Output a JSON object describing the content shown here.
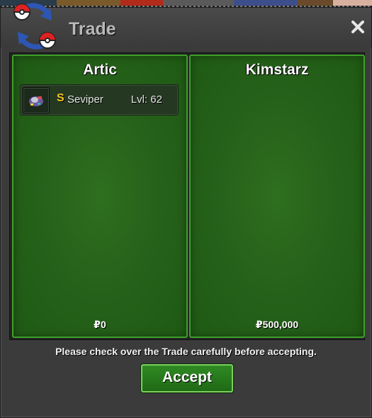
{
  "window": {
    "title": "Trade",
    "close_icon": "close-icon",
    "logo_icon": "trade-logo-icon"
  },
  "trade": {
    "left": {
      "player": "Artic",
      "items": [
        {
          "icon": "pokemon-sprite-icon",
          "badge": "S",
          "name": "Seviper",
          "level": "Lvl: 62"
        }
      ],
      "currency_symbol": "₽",
      "money": "0"
    },
    "right": {
      "player": "Kimstarz",
      "items": [],
      "currency_symbol": "₽",
      "money": "500,000"
    }
  },
  "footer": {
    "notice": "Please check over the Trade carefully before accepting.",
    "accept_label": "Accept"
  },
  "colors": {
    "panel_green": "#26611a",
    "panel_border": "#3ea02a",
    "shiny_badge": "#f3c51b",
    "accept_border": "#7bd05f"
  }
}
